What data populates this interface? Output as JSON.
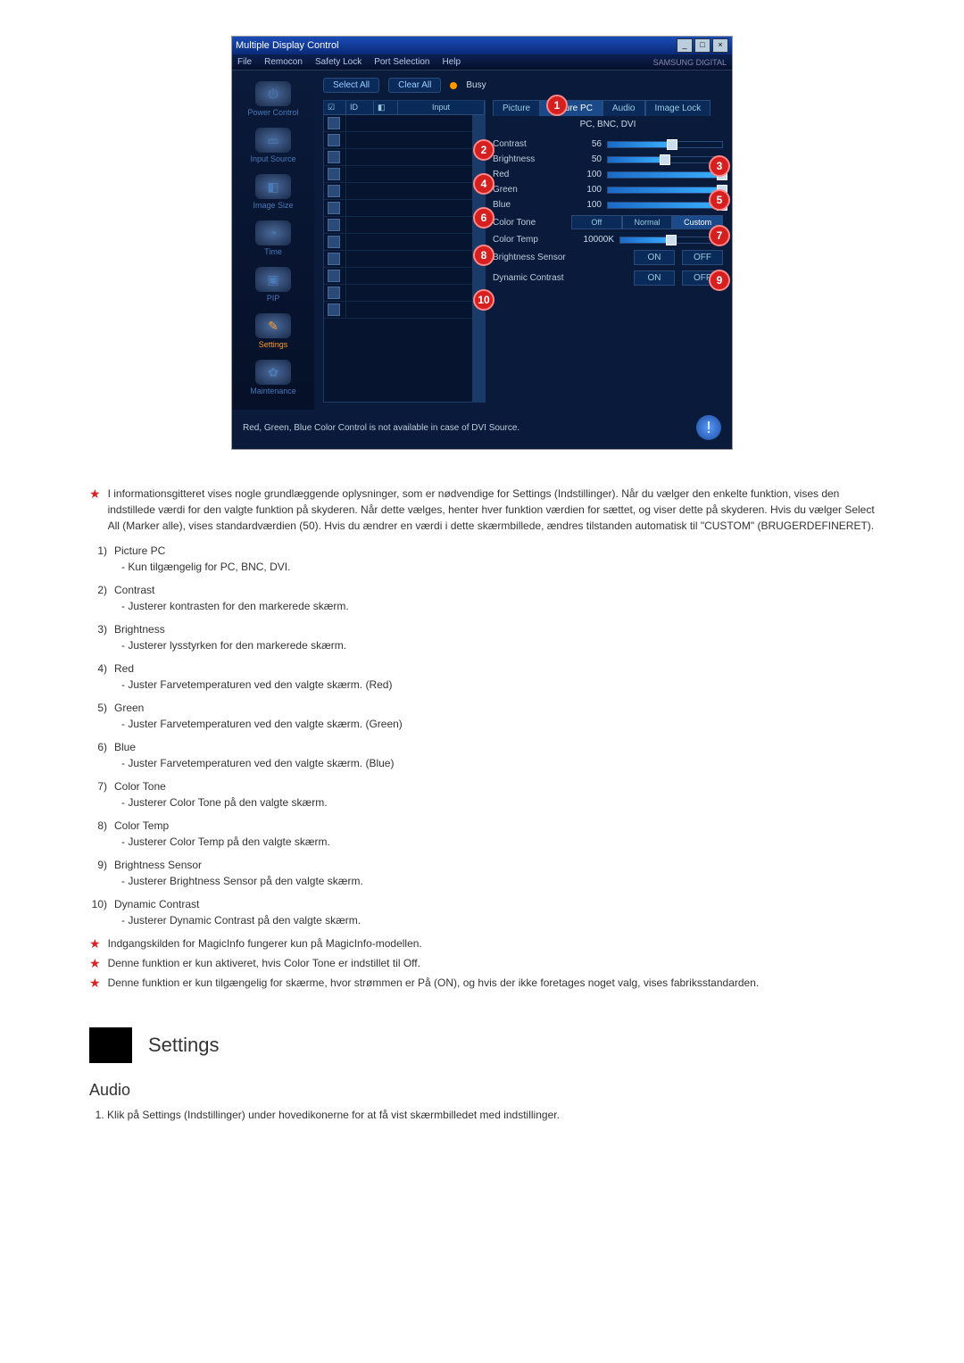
{
  "window": {
    "title": "Multiple Display Control",
    "brand": "SAMSUNG DIGITAL"
  },
  "menus": [
    "File",
    "Remocon",
    "Safety Lock",
    "Port Selection",
    "Help"
  ],
  "sidebar": [
    {
      "label": "Power Control",
      "glyph": "⏻"
    },
    {
      "label": "Input Source",
      "glyph": "▭"
    },
    {
      "label": "Image Size",
      "glyph": "◧"
    },
    {
      "label": "Time",
      "glyph": "◔"
    },
    {
      "label": "PIP",
      "glyph": "▣"
    },
    {
      "label": "Settings",
      "glyph": "✎",
      "active": true
    },
    {
      "label": "Maintenance",
      "glyph": "✿"
    }
  ],
  "topctrl": {
    "select_all": "Select All",
    "clear_all": "Clear All",
    "busy": "Busy"
  },
  "grid_headers": {
    "id": "ID",
    "input": "Input"
  },
  "tabs": [
    "Picture",
    "Picture PC",
    "Audio",
    "Image Lock"
  ],
  "active_tab": 1,
  "subhead": "PC, BNC, DVI",
  "sliders": [
    {
      "label": "Contrast",
      "val": "56",
      "pct": 56
    },
    {
      "label": "Brightness",
      "val": "50",
      "pct": 50
    },
    {
      "label": "Red",
      "val": "100",
      "pct": 100
    },
    {
      "label": "Green",
      "val": "100",
      "pct": 100
    },
    {
      "label": "Blue",
      "val": "100",
      "pct": 100
    }
  ],
  "color_tone": {
    "label": "Color Tone",
    "opts": [
      "Off",
      "Normal",
      "Custom"
    ]
  },
  "color_temp": {
    "label": "Color Temp",
    "val": "10000K",
    "pct": 50
  },
  "bsensor": {
    "label": "Brightness Sensor",
    "on": "ON",
    "off": "OFF"
  },
  "dcontrast": {
    "label": "Dynamic Contrast",
    "on": "ON",
    "off": "OFF"
  },
  "footer_msg": "Red, Green, Blue Color Control is not available in case of DVI Source.",
  "callouts": [
    "1",
    "2",
    "3",
    "4",
    "5",
    "6",
    "7",
    "8",
    "9",
    "10"
  ],
  "desc_intro": "I informationsgitteret vises nogle grundlæggende oplysninger, som er nødvendige for Settings (Indstillinger). Når du vælger den enkelte funktion, vises den indstillede værdi for den valgte funktion på skyderen. Når dette vælges, henter hver funktion værdien for sættet, og viser dette på skyderen. Hvis du vælger Select All (Marker alle), vises standardværdien (50). Hvis du ændrer en værdi i dette skærmbillede, ændres tilstanden automatisk til \"CUSTOM\" (BRUGERDEFINERET).",
  "list": [
    {
      "n": "1)",
      "t": "Picture PC",
      "s": "- Kun tilgængelig for PC, BNC, DVI."
    },
    {
      "n": "2)",
      "t": "Contrast",
      "s": "- Justerer kontrasten for den markerede skærm."
    },
    {
      "n": "3)",
      "t": "Brightness",
      "s": "- Justerer lysstyrken for den markerede skærm."
    },
    {
      "n": "4)",
      "t": "Red",
      "s": "- Juster Farvetemperaturen ved den valgte skærm. (Red)"
    },
    {
      "n": "5)",
      "t": "Green",
      "s": "- Juster Farvetemperaturen ved den valgte skærm. (Green)"
    },
    {
      "n": "6)",
      "t": "Blue",
      "s": "- Juster Farvetemperaturen ved den valgte skærm. (Blue)"
    },
    {
      "n": "7)",
      "t": "Color Tone",
      "s": "- Justerer Color Tone på den valgte skærm."
    },
    {
      "n": "8)",
      "t": "Color Temp",
      "s": "- Justerer Color Temp på den valgte skærm."
    },
    {
      "n": "9)",
      "t": "Brightness Sensor",
      "s": "- Justerer Brightness Sensor på den valgte skærm."
    },
    {
      "n": "10)",
      "t": "Dynamic Contrast",
      "s": "- Justerer Dynamic Contrast på den valgte skærm."
    }
  ],
  "notes": [
    "Indgangskilden for MagicInfo fungerer kun på MagicInfo-modellen.",
    "Denne funktion er kun aktiveret, hvis Color Tone er indstillet til Off.",
    "Denne funktion er kun tilgængelig for skærme, hvor strømmen er På (ON), og hvis der ikke foretages noget valg, vises fabriksstandarden."
  ],
  "section_title": "Settings",
  "subsection_title": "Audio",
  "subsection_item": "Klik på Settings (Indstillinger) under hovedikonerne for at få vist skærmbilledet med indstillinger."
}
